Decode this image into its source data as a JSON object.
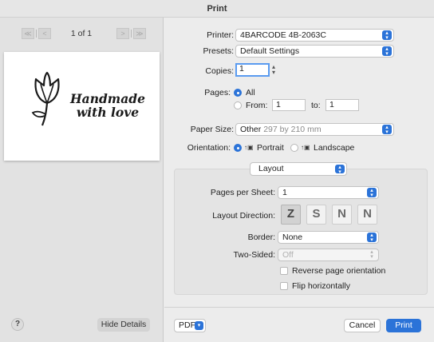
{
  "window": {
    "title": "Print"
  },
  "preview": {
    "page_indicator": "1 of 1",
    "nav_first": "≪",
    "nav_prev": "<",
    "nav_next": ">",
    "nav_last": "≫",
    "card_line1": "Handmade",
    "card_line2": "with love"
  },
  "footer_left": {
    "help_label": "?",
    "hide_details_label": "Hide Details"
  },
  "printer": {
    "label": "Printer:",
    "value": "4BARCODE 4B-2063C"
  },
  "presets": {
    "label": "Presets:",
    "value": "Default Settings"
  },
  "copies": {
    "label": "Copies:",
    "value": "1"
  },
  "pages": {
    "label": "Pages:",
    "all_label": "All",
    "from_label": "From:",
    "from_value": "1",
    "to_label": "to:",
    "to_value": "1",
    "selected": "All"
  },
  "paper_size": {
    "label": "Paper Size:",
    "value": "Other",
    "detail": "297 by 210 mm"
  },
  "orientation": {
    "label": "Orientation:",
    "portrait_label": "Portrait",
    "landscape_label": "Landscape",
    "selected": "Portrait"
  },
  "layout": {
    "section_value": "Layout",
    "pages_per_sheet_label": "Pages per Sheet:",
    "pages_per_sheet_value": "1",
    "layout_direction_label": "Layout Direction:",
    "directions": [
      "Z",
      "S",
      "N",
      "N"
    ],
    "selected_direction": 0,
    "border_label": "Border:",
    "border_value": "None",
    "two_sided_label": "Two-Sided:",
    "two_sided_value": "Off",
    "reverse_label": "Reverse page orientation",
    "reverse_checked": false,
    "flip_label": "Flip horizontally",
    "flip_checked": false
  },
  "footer_right": {
    "pdf_label": "PDF",
    "cancel_label": "Cancel",
    "print_label": "Print"
  },
  "colors": {
    "accent": "#2b73d8",
    "window_bg": "#ececec",
    "sidebar_bg": "#e2e2e2"
  }
}
